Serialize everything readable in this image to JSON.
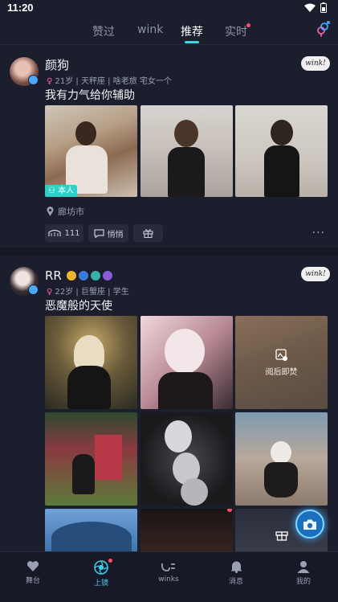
{
  "status_bar": {
    "time": "11:20"
  },
  "top_tabs": [
    {
      "label": "赞过"
    },
    {
      "label": "wink"
    },
    {
      "label": "推荐"
    },
    {
      "label": "实时"
    }
  ],
  "post1": {
    "username": "颜狗",
    "meta": "21岁 | 天秤座 | 啥老旅 宅女一个",
    "wink": "wink!",
    "caption": "我有力气给你辅助",
    "photo_tag": "本人",
    "location": "廊坊市",
    "like_count": "111",
    "whisper_label": "悄悄",
    "more": "···"
  },
  "post2": {
    "username": "RR",
    "meta": "22岁 | 巨蟹座 | 学生",
    "wink": "wink!",
    "caption": "恶魔般的天使",
    "burn_label": "阅后即焚"
  },
  "bottom_nav": [
    {
      "label": "舞台"
    },
    {
      "label": "上镜"
    },
    {
      "label": "winks"
    },
    {
      "label": "消息"
    },
    {
      "label": "我的"
    }
  ],
  "colors": {
    "accent": "#3fd6e0",
    "background": "#1b1e2c",
    "active_nav": "#44c8ea",
    "notify": "#ff4d6a"
  }
}
